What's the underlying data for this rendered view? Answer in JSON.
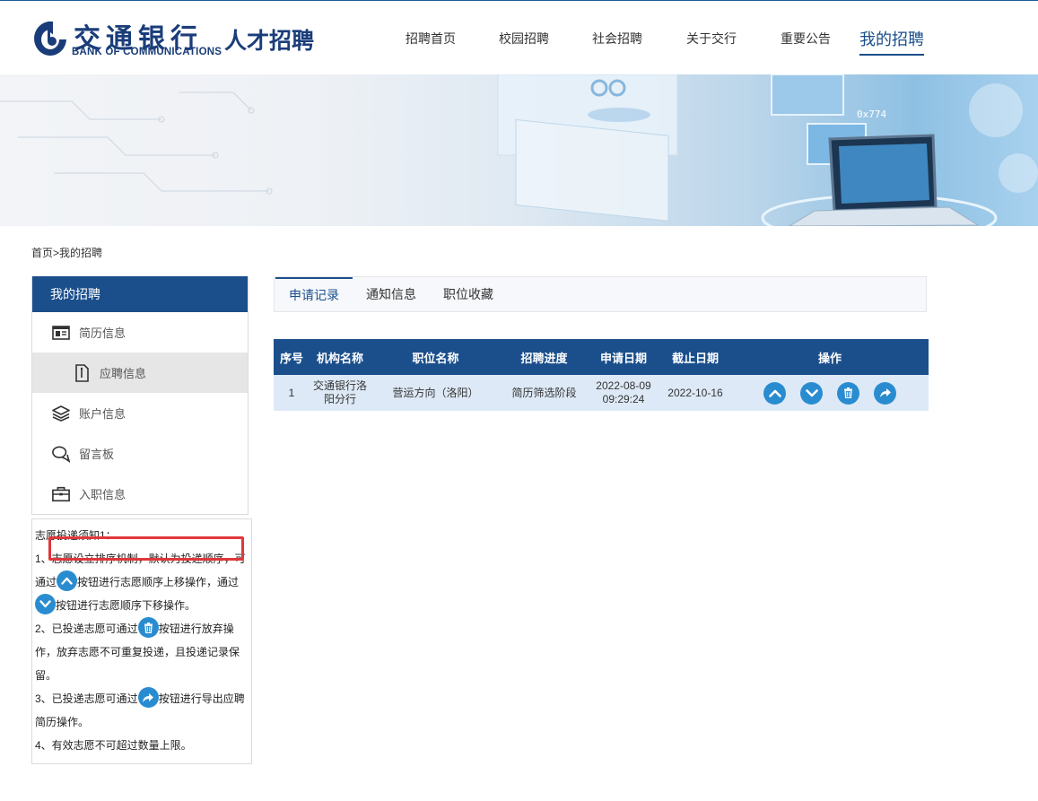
{
  "header": {
    "logo_cn": "交通银行",
    "logo_en": "BANK OF COMMUNICATIONS",
    "logo_sub": "人才招聘",
    "nav": [
      {
        "label": "招聘首页"
      },
      {
        "label": "校园招聘"
      },
      {
        "label": "社会招聘"
      },
      {
        "label": "关于交行"
      },
      {
        "label": "重要公告"
      },
      {
        "label": "我的招聘"
      }
    ],
    "active_nav": "我的招聘"
  },
  "banner": {
    "hex_text": "0x774"
  },
  "breadcrumb": {
    "home": "首页",
    "sep": ">",
    "current": "我的招聘"
  },
  "sidebar": {
    "title": "我的招聘",
    "items": [
      {
        "label": "简历信息",
        "icon": "resume-icon"
      },
      {
        "label": "应聘信息",
        "icon": "document-icon"
      },
      {
        "label": "账户信息",
        "icon": "layers-icon"
      },
      {
        "label": "留言板",
        "icon": "chat-icon"
      },
      {
        "label": "入职信息",
        "icon": "briefcase-icon"
      }
    ]
  },
  "notice": {
    "title": "志愿投递须知1：",
    "l1a": "1、志愿设立排序机制，默认为投递顺序，可",
    "l1b": "通过",
    "l1c": "按钮进行志愿顺序上移操作，通过",
    "l1d": "按钮进行志愿顺序下移操作。",
    "l2a": "2、已投递志愿可通过",
    "l2b": "按钮进行放弃操",
    "l2c": "作，放弃志愿不可重复投递，且投递记录保",
    "l2d": "留。",
    "l3a": "3、已投递志愿可通过",
    "l3b": "按钮进行导出应聘",
    "l3c": "简历操作。",
    "l4": "4、有效志愿不可超过数量上限。"
  },
  "tabs": [
    {
      "label": "申请记录"
    },
    {
      "label": "通知信息"
    },
    {
      "label": "职位收藏"
    }
  ],
  "table": {
    "headers": [
      "序号",
      "机构名称",
      "职位名称",
      "招聘进度",
      "申请日期",
      "截止日期",
      "操作"
    ],
    "rows": [
      {
        "no": "1",
        "org_line1": "交通银行洛",
        "org_line2": "阳分行",
        "position": "营运方向（洛阳）",
        "progress": "简历筛选阶段",
        "apply_date": "2022-08-09",
        "apply_time": "09:29:24",
        "deadline": "2022-10-16"
      }
    ]
  },
  "colors": {
    "brand": "#1b4f8c",
    "button": "#2a8cd0",
    "highlight": "#e0373b",
    "row_bg": "#dde9f6"
  }
}
